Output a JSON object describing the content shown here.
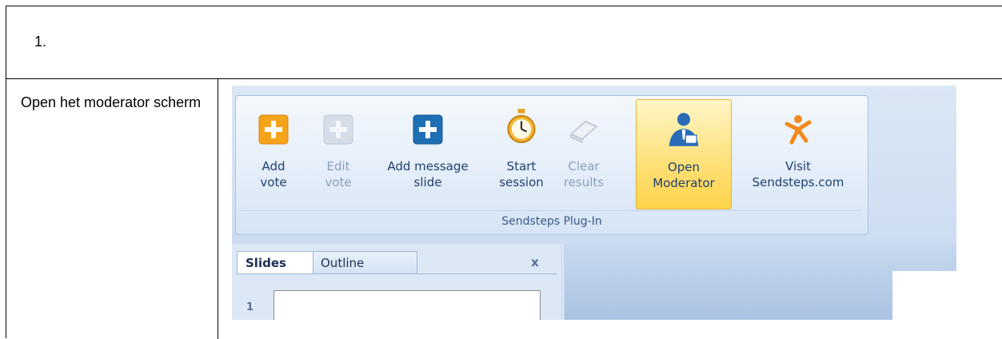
{
  "document": {
    "step_number": "1.",
    "step_instruction": "Open het moderator scherm"
  },
  "ribbon": {
    "group_label": "Sendsteps Plug-In",
    "buttons": [
      {
        "line1": "Add",
        "line2": "vote",
        "icon": "add-plus-icon",
        "enabled": true,
        "active": false
      },
      {
        "line1": "Edit",
        "line2": "vote",
        "icon": "edit-plus-icon",
        "enabled": false,
        "active": false
      },
      {
        "line1": "Add message",
        "line2": "slide",
        "icon": "add-message-plus-icon",
        "enabled": true,
        "active": false
      },
      {
        "line1": "Start",
        "line2": "session",
        "icon": "stopwatch-icon",
        "enabled": true,
        "active": false
      },
      {
        "line1": "Clear",
        "line2": "results",
        "icon": "eraser-icon",
        "enabled": false,
        "active": false
      },
      {
        "line1": "Open",
        "line2": "Moderator",
        "icon": "moderator-person-icon",
        "enabled": true,
        "active": true
      },
      {
        "line1": "Visit",
        "line2": "Sendsteps.com",
        "icon": "sendsteps-logo-icon",
        "enabled": true,
        "active": false
      }
    ]
  },
  "slides_pane": {
    "tab_slides": "Slides",
    "tab_outline": "Outline",
    "close_glyph": "x",
    "slide_number": "1"
  },
  "colors": {
    "ribbon_label": "#1e3f6f",
    "active_highlight": "#ffd24a",
    "add_vote_orange": "#f5a31a",
    "add_message_blue": "#1f6fb5"
  }
}
